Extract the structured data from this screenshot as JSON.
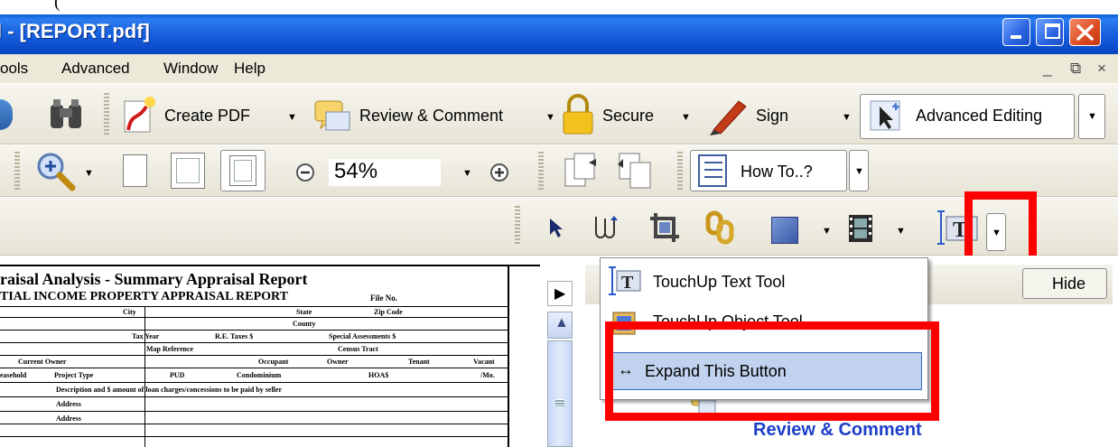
{
  "caption": {
    "partial_text": "(         "
  },
  "window": {
    "title": "l - [REPORT.pdf]",
    "min_icon": "minimize-icon",
    "max_icon": "restore-icon",
    "close_icon": "close-icon"
  },
  "menu": {
    "items": [
      "ools",
      "Advanced",
      "Window",
      "Help"
    ],
    "doc_controls": [
      "_",
      "⧉",
      "×"
    ]
  },
  "toolbar1": {
    "create_pdf": "Create PDF",
    "review_comment": "Review & Comment",
    "secure": "Secure",
    "sign": "Sign",
    "advanced_editing": "Advanced Editing"
  },
  "toolbar2": {
    "zoom_value": "54%",
    "how_to": "How To..?"
  },
  "popup": {
    "items": [
      {
        "label": "TouchUp Text Tool",
        "icon": "touchup-text-icon"
      },
      {
        "label": "TouchUp Object Tool",
        "icon": "touchup-object-icon"
      },
      {
        "label": "Expand This Button",
        "icon": "expand-arrows-icon"
      }
    ]
  },
  "right_pane": {
    "hide_button": "Hide",
    "review_comment_link": "Review & Comment"
  },
  "document": {
    "heading": "raisal Analysis - Summary Appraisal Report",
    "subheading": "TIAL INCOME PROPERTY APPRAISAL REPORT",
    "file_no": "File No.",
    "file_no_value": "",
    "fields": [
      "City",
      "State",
      "Zip Code",
      "County",
      "Tax Year",
      "R.E. Taxes $",
      "Special Assessments $",
      "Map Reference",
      "Census Tract",
      "Current Owner",
      "Occupant",
      "Owner",
      "Tenant",
      "Vacant",
      "easehold",
      "Project Type",
      "PUD",
      "Condominium",
      "HOA$",
      "/Mo.",
      "Description and $ amount of loan charges/concessions to be paid by seller",
      "Address",
      "Address"
    ]
  },
  "colors": {
    "titlebar": "#0c4fcf",
    "highlight_box": "#ff0000",
    "link_blue": "#1c3fc8",
    "selected_item": "#c1d2ee"
  }
}
